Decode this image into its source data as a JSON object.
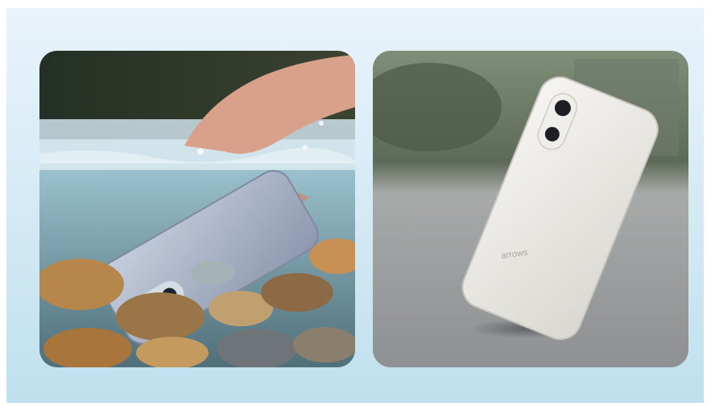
{
  "images": [
    {
      "label": "waterproof-photo",
      "colors": {
        "water": "#7fa7b7",
        "phone": "#aab4c8",
        "rocks": "#b88a4e",
        "skin": "#d9a08b"
      }
    },
    {
      "label": "drop-resistant-photo",
      "brand_text": "arrows",
      "colors": {
        "phone": "#ecebe7",
        "ground": "#8f9196",
        "background": "#5a6a55"
      }
    }
  ]
}
